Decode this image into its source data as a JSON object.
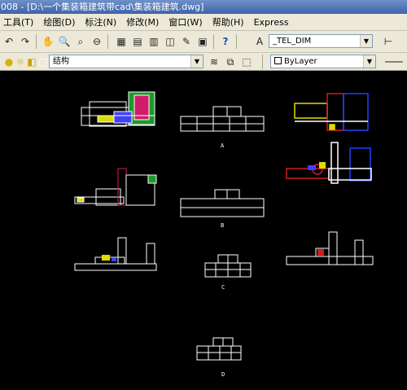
{
  "title_bar": {
    "title": "008 - [D:\\一个集装箱建筑带cad\\集装箱建筑.dwg]"
  },
  "menu": {
    "items": [
      "工具(T)",
      "绘图(D)",
      "标注(N)",
      "修改(M)",
      "窗口(W)",
      "帮助(H)",
      "Express"
    ]
  },
  "toolbar": {
    "text_style": "_TEL_DIM",
    "layer_name": "结构",
    "color_control": "ByLayer"
  },
  "drawing": {
    "labels": [
      "A",
      "B",
      "C",
      "D"
    ]
  },
  "colors": {
    "background": "#000000",
    "lines": "#ffffff",
    "ui_face": "#ece9d8"
  }
}
